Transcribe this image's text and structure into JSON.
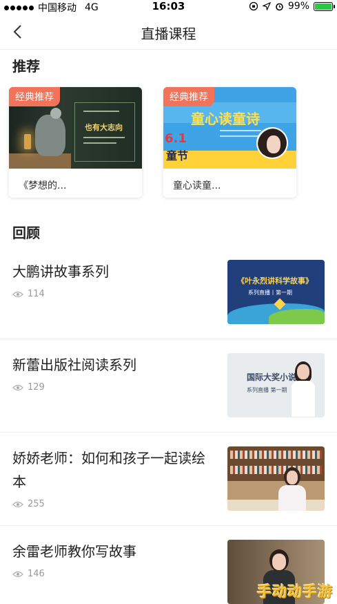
{
  "status_bar": {
    "carrier": "中国移动",
    "network": "4G",
    "time": "16:03",
    "battery": "99%",
    "battery_level": 0.99,
    "icons": [
      "signal-dots-icon",
      "orientation-lock-icon",
      "location-icon",
      "alarm-icon",
      "battery-icon"
    ]
  },
  "nav": {
    "back_icon": "chevron-left-icon",
    "title": "直播课程"
  },
  "recommended": {
    "heading": "推荐",
    "cards": [
      {
        "badge": "经典推荐",
        "caption": "《梦想的...",
        "poster_text": "也有大志向"
      },
      {
        "badge": "经典推荐",
        "caption": "童心读童...",
        "poster_text": "童心读童诗",
        "poster_date": "6.1",
        "poster_sub": "童节"
      }
    ]
  },
  "review": {
    "heading": "回顾",
    "items": [
      {
        "title": "大鹏讲故事系列",
        "views": "114",
        "thumb_title": "《叶永烈讲科学故事》",
        "thumb_sub": "系列直播丨第一期"
      },
      {
        "title": "新蕾出版社阅读系列",
        "views": "129",
        "thumb_title": "国际大奖小说",
        "thumb_sub": "系列直播 第一期"
      },
      {
        "title": "娇娇老师：如何和孩子一起读绘本",
        "views": "255"
      },
      {
        "title": "余雷老师教你写故事",
        "views": "146"
      }
    ]
  },
  "watermark": "手动动手游",
  "colors": {
    "badge": "#f1735a",
    "battery_fill": "#2ac845",
    "muted_text": "#9a9a9a"
  }
}
